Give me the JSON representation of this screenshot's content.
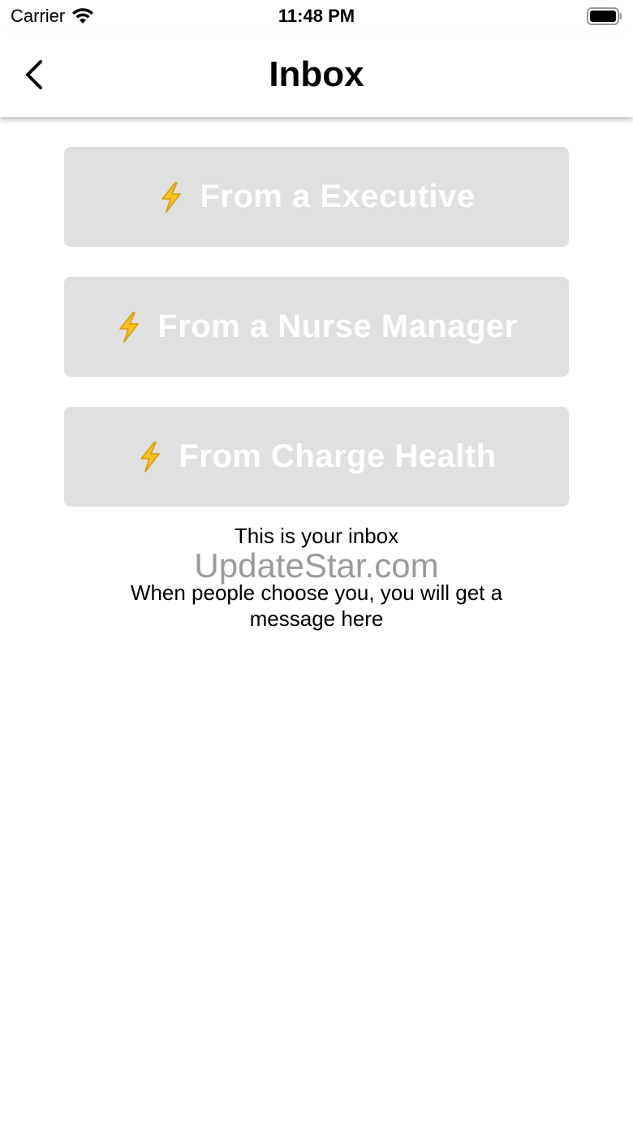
{
  "status_bar": {
    "carrier": "Carrier",
    "time": "11:48 PM",
    "wifi_icon": "wifi-icon",
    "battery_icon": "battery-icon"
  },
  "nav": {
    "title": "Inbox",
    "back_icon": "chevron-left-icon"
  },
  "buttons": [
    {
      "label": "From a Executive",
      "icon": "lightning-bolt-icon"
    },
    {
      "label": "From a Nurse Manager",
      "icon": "lightning-bolt-icon"
    },
    {
      "label": "From Charge Health",
      "icon": "lightning-bolt-icon"
    }
  ],
  "empty_state": {
    "title": "This is your inbox",
    "message": "When people choose you, you will get a message here"
  },
  "watermark": "UpdateStar.com",
  "colors": {
    "button_bg": "#e0e0e0",
    "button_text": "#ffffff",
    "bolt": "#f7c21e"
  }
}
